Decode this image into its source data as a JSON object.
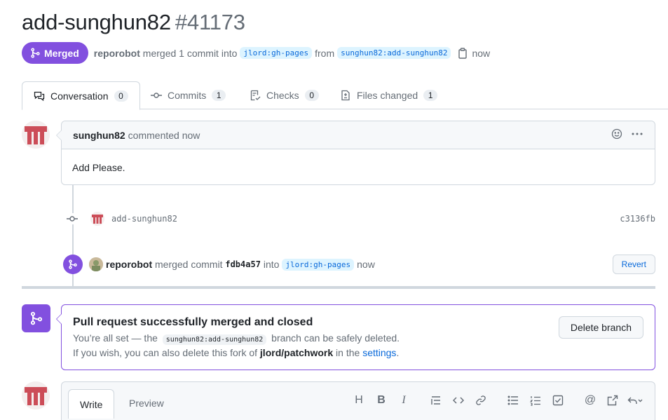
{
  "header": {
    "title": "add-sunghun82",
    "number": "#41173"
  },
  "meta": {
    "state": "Merged",
    "user": "reporobot",
    "merged_text": "merged 1 commit into",
    "base_branch": "jlord:gh-pages",
    "from_text": "from",
    "head_branch": "sunghun82:add-sunghun82",
    "time": "now"
  },
  "tabs": [
    {
      "label": "Conversation",
      "count": "0"
    },
    {
      "label": "Commits",
      "count": "1"
    },
    {
      "label": "Checks",
      "count": "0"
    },
    {
      "label": "Files changed",
      "count": "1"
    }
  ],
  "comment": {
    "author": "sunghun82",
    "action": "commented now",
    "body": "Add Please."
  },
  "commit": {
    "message": "add-sunghun82",
    "sha": "c3136fb"
  },
  "merge_event": {
    "user": "reporobot",
    "text1": "merged commit",
    "sha": "fdb4a57",
    "text2": "into",
    "branch": "jlord:gh-pages",
    "time": "now",
    "revert_label": "Revert"
  },
  "merge_status": {
    "title": "Pull request successfully merged and closed",
    "line1_pre": "You’re all set — the",
    "line1_branch": "sunghun82:add-sunghun82",
    "line1_post": "branch can be safely deleted.",
    "line2_pre": "If you wish, you can also delete this fork of",
    "line2_repo": "jlord/patchwork",
    "line2_mid": "in the",
    "line2_link": "settings",
    "line2_end": ".",
    "delete_label": "Delete branch"
  },
  "editor": {
    "write_label": "Write",
    "preview_label": "Preview",
    "tools": [
      "heading-icon",
      "bold-icon",
      "italic-icon",
      "quote-icon",
      "code-icon",
      "link-icon",
      "unordered-list-icon",
      "ordered-list-icon",
      "task-list-icon",
      "mention-icon",
      "reference-icon",
      "undo-icon"
    ],
    "tool_glyphs": {
      "heading": "H",
      "bold": "B",
      "italic": "I",
      "mention": "@"
    }
  },
  "colors": {
    "merged": "#8250df",
    "link": "#0969da",
    "muted": "#656d76",
    "border": "#d0d7de"
  }
}
